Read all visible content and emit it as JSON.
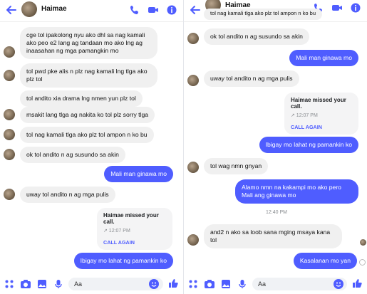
{
  "left": {
    "contact_name": "Haimae",
    "messages": [
      "cge tol ipakolong nyu ako dhl sa nag kamali ako peo e2 lang ag tandaan mo ako lng ag inaasahan ng mga pamangkin mo",
      "tol pwd pke alis n plz nag kamali lng tlga ako plz tol",
      "tol andito xia drama lng nmen yun plz tol",
      "msakit lang tlga ag nakita ko tol plz sorry tlga",
      "tol nag kamali tlga ako plz tol ampon n ko bu",
      "ok tol andito n ag susundo sa akin",
      "Mali man ginawa mo",
      "uway tol andito n ag mga pulis",
      "Ibigay mo lahat ng pamankin ko"
    ],
    "missed_call": {
      "title": "Haimae missed your call.",
      "time": "↗ 12:07 PM",
      "action": "CALL AGAIN"
    },
    "composer_placeholder": "Aa"
  },
  "right": {
    "contact_name": "Haimae",
    "top_partial": "tol nag kamali tlga ako plz tol ampon n ko bu",
    "messages": [
      "ok tol andito n ag susundo sa akin",
      "Mali man ginawa mo",
      "uway tol andito n ag mga pulis",
      "Ibigay mo lahat ng pamankin ko",
      "tol wag nmn gnyan",
      "Alamo nmn na kakampi mo ako pero Mali ang ginawa mo",
      "and2 n ako sa loob sana mging msaya kana tol",
      "Kasalanan mo yan"
    ],
    "timestamp": "12:40 PM",
    "missed_call": {
      "title": "Haimae missed your call.",
      "time": "↗ 12:07 PM",
      "action": "CALL AGAIN"
    },
    "composer_placeholder": "Aa"
  },
  "colors": {
    "accent": "#4f5dff",
    "incoming_bg": "#f0f0f0"
  }
}
